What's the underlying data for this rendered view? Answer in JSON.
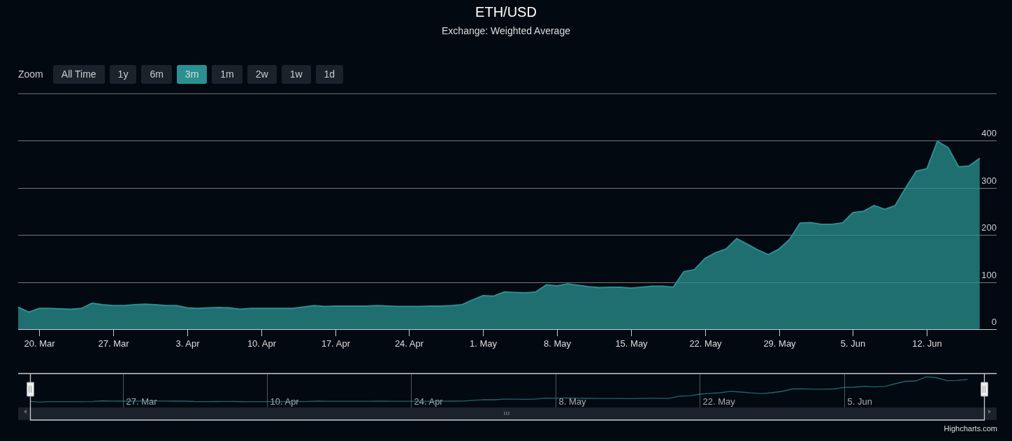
{
  "title": "ETH/USD",
  "subtitle": "Exchange: Weighted Average",
  "zoom": {
    "label": "Zoom",
    "buttons": [
      {
        "label": "All Time",
        "selected": false
      },
      {
        "label": "1y",
        "selected": false
      },
      {
        "label": "6m",
        "selected": false
      },
      {
        "label": "3m",
        "selected": true
      },
      {
        "label": "1m",
        "selected": false
      },
      {
        "label": "2w",
        "selected": false
      },
      {
        "label": "1w",
        "selected": false
      },
      {
        "label": "1d",
        "selected": false
      }
    ]
  },
  "chart_data": {
    "type": "area",
    "categories": [
      null,
      null,
      "20. Mar",
      null,
      null,
      null,
      null,
      null,
      null,
      "27. Mar",
      null,
      null,
      null,
      null,
      null,
      null,
      "3. Apr",
      null,
      null,
      null,
      null,
      null,
      null,
      "10. Apr",
      null,
      null,
      null,
      null,
      null,
      null,
      "17. Apr",
      null,
      null,
      null,
      null,
      null,
      null,
      "24. Apr",
      null,
      null,
      null,
      null,
      null,
      null,
      "1. May",
      null,
      null,
      null,
      null,
      null,
      null,
      "8. May",
      null,
      null,
      null,
      null,
      null,
      null,
      "15. May",
      null,
      null,
      null,
      null,
      null,
      null,
      "22. May",
      null,
      null,
      null,
      null,
      null,
      null,
      "29. May",
      null,
      null,
      null,
      null,
      null,
      null,
      "5. Jun",
      null,
      null,
      null,
      null,
      null,
      null,
      "12. Jun",
      null,
      null,
      null,
      null,
      null
    ],
    "series": [
      {
        "color": "#2a9090",
        "values": [
          47,
          36,
          44,
          44,
          43,
          42,
          44,
          55,
          52,
          50,
          50,
          52,
          53,
          52,
          50,
          50,
          45,
          44,
          45,
          46,
          45,
          42,
          44,
          44,
          44,
          44,
          44,
          47,
          50,
          48,
          49,
          49,
          49,
          49,
          50,
          49,
          48,
          48,
          48,
          49,
          49,
          50,
          52,
          62,
          71,
          70,
          79,
          78,
          77,
          79,
          94,
          92,
          96,
          93,
          90,
          88,
          89,
          89,
          87,
          89,
          91,
          91,
          89,
          122,
          126,
          150,
          162,
          170,
          192,
          180,
          168,
          158,
          170,
          190,
          225,
          226,
          222,
          222,
          225,
          247,
          250,
          262,
          254,
          262,
          300,
          335,
          340,
          398,
          385,
          344,
          346,
          362
        ]
      }
    ],
    "ylim": [
      0,
      500
    ],
    "grid": true,
    "yticks": [
      0,
      100,
      200,
      300,
      400
    ]
  },
  "navigator": {
    "ticks": [
      "27. Mar",
      "10. Apr",
      "24. Apr",
      "8. May",
      "22. May",
      "5. Jun"
    ]
  },
  "credit": "Highcharts.com"
}
